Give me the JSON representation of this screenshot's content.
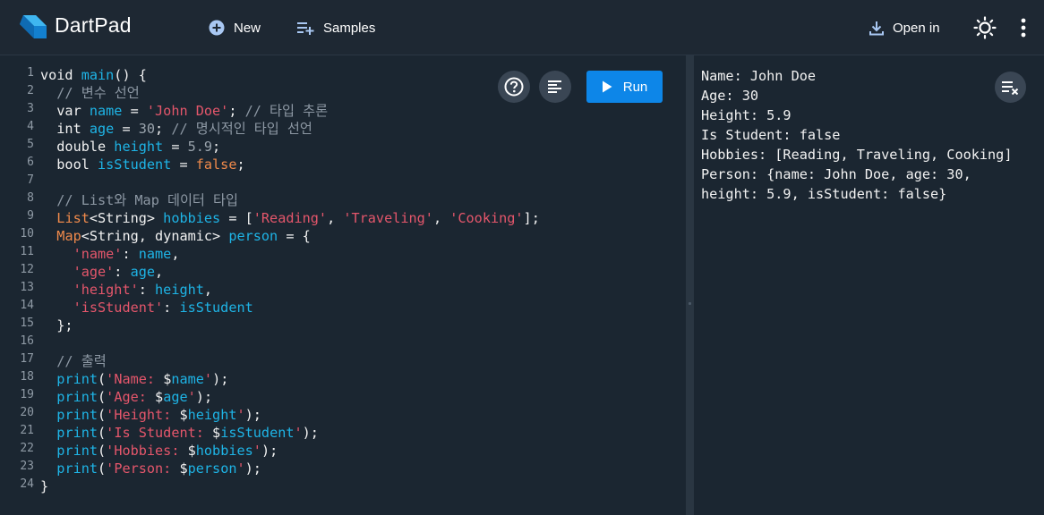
{
  "header": {
    "app_title": "DartPad",
    "new_label": "New",
    "samples_label": "Samples",
    "open_in_label": "Open in"
  },
  "colors": {
    "accent": "#0d86e8",
    "background": "#1b2631",
    "keyword_color": "#f2f2f2",
    "identifier_color": "#1eb4e6",
    "string_color": "#e4566b",
    "comment_color": "#8d98a4",
    "type_color": "#f08a4b"
  },
  "icons": {
    "logo": "dart-logo-icon",
    "new": "plus-circle-icon",
    "samples": "playlist-add-icon",
    "open_in": "download-icon",
    "theme": "brightness-icon",
    "more": "more-vert-icon",
    "help": "help-circle-icon",
    "format": "format-align-icon",
    "run": "play-icon",
    "clear": "clear-all-icon"
  },
  "editor": {
    "run_label": "Run",
    "lines": [
      {
        "n": "1",
        "tokens": [
          {
            "t": "void ",
            "c": "kw"
          },
          {
            "t": "main",
            "c": "fn"
          },
          {
            "t": "() {",
            "c": "pl"
          }
        ]
      },
      {
        "n": "2",
        "tokens": [
          {
            "t": "  // 변수 선언",
            "c": "cmt"
          }
        ]
      },
      {
        "n": "3",
        "tokens": [
          {
            "t": "  var ",
            "c": "kw"
          },
          {
            "t": "name",
            "c": "fn"
          },
          {
            "t": " = ",
            "c": "pl"
          },
          {
            "t": "'John Doe'",
            "c": "str"
          },
          {
            "t": "; ",
            "c": "pl"
          },
          {
            "t": "// 타입 추론",
            "c": "cmt"
          }
        ]
      },
      {
        "n": "4",
        "tokens": [
          {
            "t": "  int ",
            "c": "kw"
          },
          {
            "t": "age",
            "c": "fn"
          },
          {
            "t": " = ",
            "c": "pl"
          },
          {
            "t": "30",
            "c": "num"
          },
          {
            "t": "; ",
            "c": "pl"
          },
          {
            "t": "// 명시적인 타입 선언",
            "c": "cmt"
          }
        ]
      },
      {
        "n": "5",
        "tokens": [
          {
            "t": "  double ",
            "c": "kw"
          },
          {
            "t": "height",
            "c": "fn"
          },
          {
            "t": " = ",
            "c": "pl"
          },
          {
            "t": "5.9",
            "c": "num"
          },
          {
            "t": ";",
            "c": "pl"
          }
        ]
      },
      {
        "n": "6",
        "tokens": [
          {
            "t": "  bool ",
            "c": "kw"
          },
          {
            "t": "isStudent",
            "c": "fn"
          },
          {
            "t": " = ",
            "c": "pl"
          },
          {
            "t": "false",
            "c": "bool"
          },
          {
            "t": ";",
            "c": "pl"
          }
        ]
      },
      {
        "n": "7",
        "tokens": []
      },
      {
        "n": "8",
        "tokens": [
          {
            "t": "  // List와 Map 데이터 타입",
            "c": "cmt"
          }
        ]
      },
      {
        "n": "9",
        "tokens": [
          {
            "t": "  ",
            "c": "pl"
          },
          {
            "t": "List",
            "c": "type"
          },
          {
            "t": "<String> ",
            "c": "pl"
          },
          {
            "t": "hobbies",
            "c": "fn"
          },
          {
            "t": " = [",
            "c": "pl"
          },
          {
            "t": "'Reading'",
            "c": "str"
          },
          {
            "t": ", ",
            "c": "pl"
          },
          {
            "t": "'Traveling'",
            "c": "str"
          },
          {
            "t": ", ",
            "c": "pl"
          },
          {
            "t": "'Cooking'",
            "c": "str"
          },
          {
            "t": "];",
            "c": "pl"
          }
        ]
      },
      {
        "n": "10",
        "tokens": [
          {
            "t": "  ",
            "c": "pl"
          },
          {
            "t": "Map",
            "c": "type"
          },
          {
            "t": "<String, dynamic> ",
            "c": "pl"
          },
          {
            "t": "person",
            "c": "fn"
          },
          {
            "t": " = {",
            "c": "pl"
          }
        ]
      },
      {
        "n": "11",
        "tokens": [
          {
            "t": "    ",
            "c": "pl"
          },
          {
            "t": "'name'",
            "c": "str"
          },
          {
            "t": ": ",
            "c": "pl"
          },
          {
            "t": "name",
            "c": "fn"
          },
          {
            "t": ",",
            "c": "pl"
          }
        ]
      },
      {
        "n": "12",
        "tokens": [
          {
            "t": "    ",
            "c": "pl"
          },
          {
            "t": "'age'",
            "c": "str"
          },
          {
            "t": ": ",
            "c": "pl"
          },
          {
            "t": "age",
            "c": "fn"
          },
          {
            "t": ",",
            "c": "pl"
          }
        ]
      },
      {
        "n": "13",
        "tokens": [
          {
            "t": "    ",
            "c": "pl"
          },
          {
            "t": "'height'",
            "c": "str"
          },
          {
            "t": ": ",
            "c": "pl"
          },
          {
            "t": "height",
            "c": "fn"
          },
          {
            "t": ",",
            "c": "pl"
          }
        ]
      },
      {
        "n": "14",
        "tokens": [
          {
            "t": "    ",
            "c": "pl"
          },
          {
            "t": "'isStudent'",
            "c": "str"
          },
          {
            "t": ": ",
            "c": "pl"
          },
          {
            "t": "isStudent",
            "c": "fn"
          }
        ]
      },
      {
        "n": "15",
        "tokens": [
          {
            "t": "  };",
            "c": "pl"
          }
        ]
      },
      {
        "n": "16",
        "tokens": []
      },
      {
        "n": "17",
        "tokens": [
          {
            "t": "  // 출력",
            "c": "cmt"
          }
        ]
      },
      {
        "n": "18",
        "tokens": [
          {
            "t": "  ",
            "c": "pl"
          },
          {
            "t": "print",
            "c": "fn"
          },
          {
            "t": "(",
            "c": "pl"
          },
          {
            "t": "'Name: ",
            "c": "str"
          },
          {
            "t": "$",
            "c": "pl"
          },
          {
            "t": "name",
            "c": "fn"
          },
          {
            "t": "'",
            "c": "str"
          },
          {
            "t": ");",
            "c": "pl"
          }
        ]
      },
      {
        "n": "19",
        "tokens": [
          {
            "t": "  ",
            "c": "pl"
          },
          {
            "t": "print",
            "c": "fn"
          },
          {
            "t": "(",
            "c": "pl"
          },
          {
            "t": "'Age: ",
            "c": "str"
          },
          {
            "t": "$",
            "c": "pl"
          },
          {
            "t": "age",
            "c": "fn"
          },
          {
            "t": "'",
            "c": "str"
          },
          {
            "t": ");",
            "c": "pl"
          }
        ]
      },
      {
        "n": "20",
        "tokens": [
          {
            "t": "  ",
            "c": "pl"
          },
          {
            "t": "print",
            "c": "fn"
          },
          {
            "t": "(",
            "c": "pl"
          },
          {
            "t": "'Height: ",
            "c": "str"
          },
          {
            "t": "$",
            "c": "pl"
          },
          {
            "t": "height",
            "c": "fn"
          },
          {
            "t": "'",
            "c": "str"
          },
          {
            "t": ");",
            "c": "pl"
          }
        ]
      },
      {
        "n": "21",
        "tokens": [
          {
            "t": "  ",
            "c": "pl"
          },
          {
            "t": "print",
            "c": "fn"
          },
          {
            "t": "(",
            "c": "pl"
          },
          {
            "t": "'Is Student: ",
            "c": "str"
          },
          {
            "t": "$",
            "c": "pl"
          },
          {
            "t": "isStudent",
            "c": "fn"
          },
          {
            "t": "'",
            "c": "str"
          },
          {
            "t": ");",
            "c": "pl"
          }
        ]
      },
      {
        "n": "22",
        "tokens": [
          {
            "t": "  ",
            "c": "pl"
          },
          {
            "t": "print",
            "c": "fn"
          },
          {
            "t": "(",
            "c": "pl"
          },
          {
            "t": "'Hobbies: ",
            "c": "str"
          },
          {
            "t": "$",
            "c": "pl"
          },
          {
            "t": "hobbies",
            "c": "fn"
          },
          {
            "t": "'",
            "c": "str"
          },
          {
            "t": ");",
            "c": "pl"
          }
        ]
      },
      {
        "n": "23",
        "tokens": [
          {
            "t": "  ",
            "c": "pl"
          },
          {
            "t": "print",
            "c": "fn"
          },
          {
            "t": "(",
            "c": "pl"
          },
          {
            "t": "'Person: ",
            "c": "str"
          },
          {
            "t": "$",
            "c": "pl"
          },
          {
            "t": "person",
            "c": "fn"
          },
          {
            "t": "'",
            "c": "str"
          },
          {
            "t": ");",
            "c": "pl"
          }
        ]
      },
      {
        "n": "24",
        "tokens": [
          {
            "t": "}",
            "c": "pl"
          }
        ]
      }
    ]
  },
  "output": {
    "lines": [
      "Name: John Doe",
      "Age: 30",
      "Height: 5.9",
      "Is Student: false",
      "Hobbies: [Reading, Traveling, Cooking]",
      "Person: {name: John Doe, age: 30,",
      "height: 5.9, isStudent: false}"
    ]
  }
}
